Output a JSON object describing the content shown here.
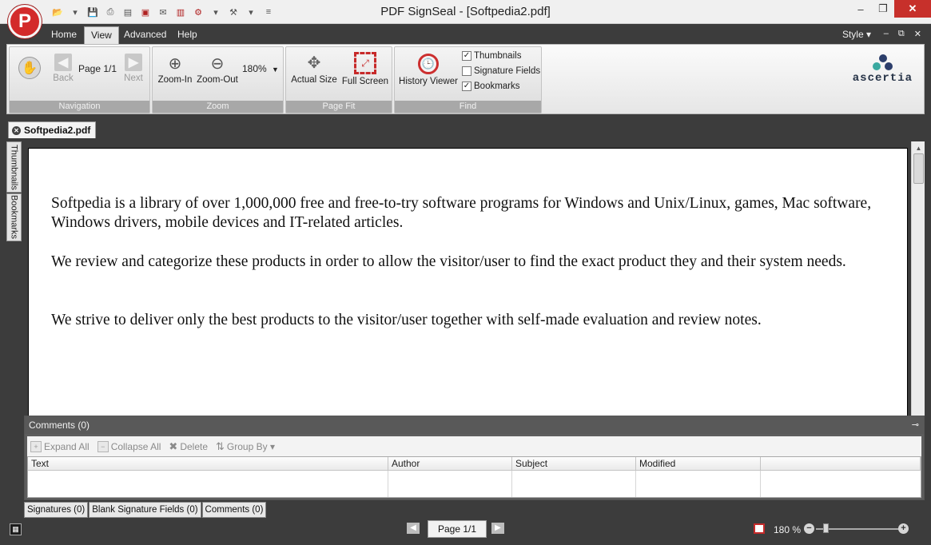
{
  "window": {
    "title": "PDF SignSeal - [Softpedia2.pdf]",
    "app_logo_letter": "P",
    "controls": [
      "–",
      "❐",
      "✕"
    ]
  },
  "ribbon_tabs": [
    "Home",
    "View",
    "Advanced",
    "Help"
  ],
  "active_tab": "View",
  "style_menu": "Style ▾",
  "mdi_controls": [
    "–",
    "⧉",
    "✕"
  ],
  "groups": {
    "navigation": {
      "label": "Navigation",
      "back": "Back",
      "next": "Next",
      "page": "Page 1/1"
    },
    "zoom": {
      "label": "Zoom",
      "zoom_in": "Zoom-In",
      "zoom_out": "Zoom-Out",
      "value": "180%"
    },
    "page_fit": {
      "label": "Page Fit",
      "actual_size": "Actual Size",
      "full_screen": "Full Screen"
    },
    "find": {
      "label": "Find",
      "history_viewer": "History Viewer",
      "checks": [
        {
          "label": "Thumbnails",
          "checked": true
        },
        {
          "label": "Signature Fields",
          "checked": false
        },
        {
          "label": "Bookmarks",
          "checked": true
        }
      ]
    }
  },
  "brand": "ascertia",
  "document_tab": "Softpedia2.pdf",
  "side_tabs": [
    "Thumbnails",
    "Bookmarks"
  ],
  "document": {
    "paragraphs": [
      "Softpedia is a library of over 1,000,000 free and free-to-try software programs for Windows and Unix/Linux, games, Mac software, Windows drivers, mobile devices and IT-related articles.",
      "We review and categorize these products in order to allow the visitor/user to find the exact product they and their system needs.",
      "We strive to deliver only the best products to the visitor/user together with self-made evaluation and review notes."
    ]
  },
  "comments": {
    "title": "Comments (0)",
    "toolbar": [
      "Expand All",
      "Collapse All",
      "Delete",
      "Group By ▾"
    ],
    "columns": [
      "Text",
      "Author",
      "Subject",
      "Modified"
    ]
  },
  "bottom_tabs": [
    "Signatures (0)",
    "Blank Signature Fields (0)",
    "Comments (0)"
  ],
  "status": {
    "page": "Page 1/1",
    "zoom": "180 %",
    "zoom_fraction": 0.12
  },
  "colors": {
    "chrome_dark": "#3c3c3c",
    "accent_red": "#c72a2a",
    "brand_navy": "#253246"
  }
}
